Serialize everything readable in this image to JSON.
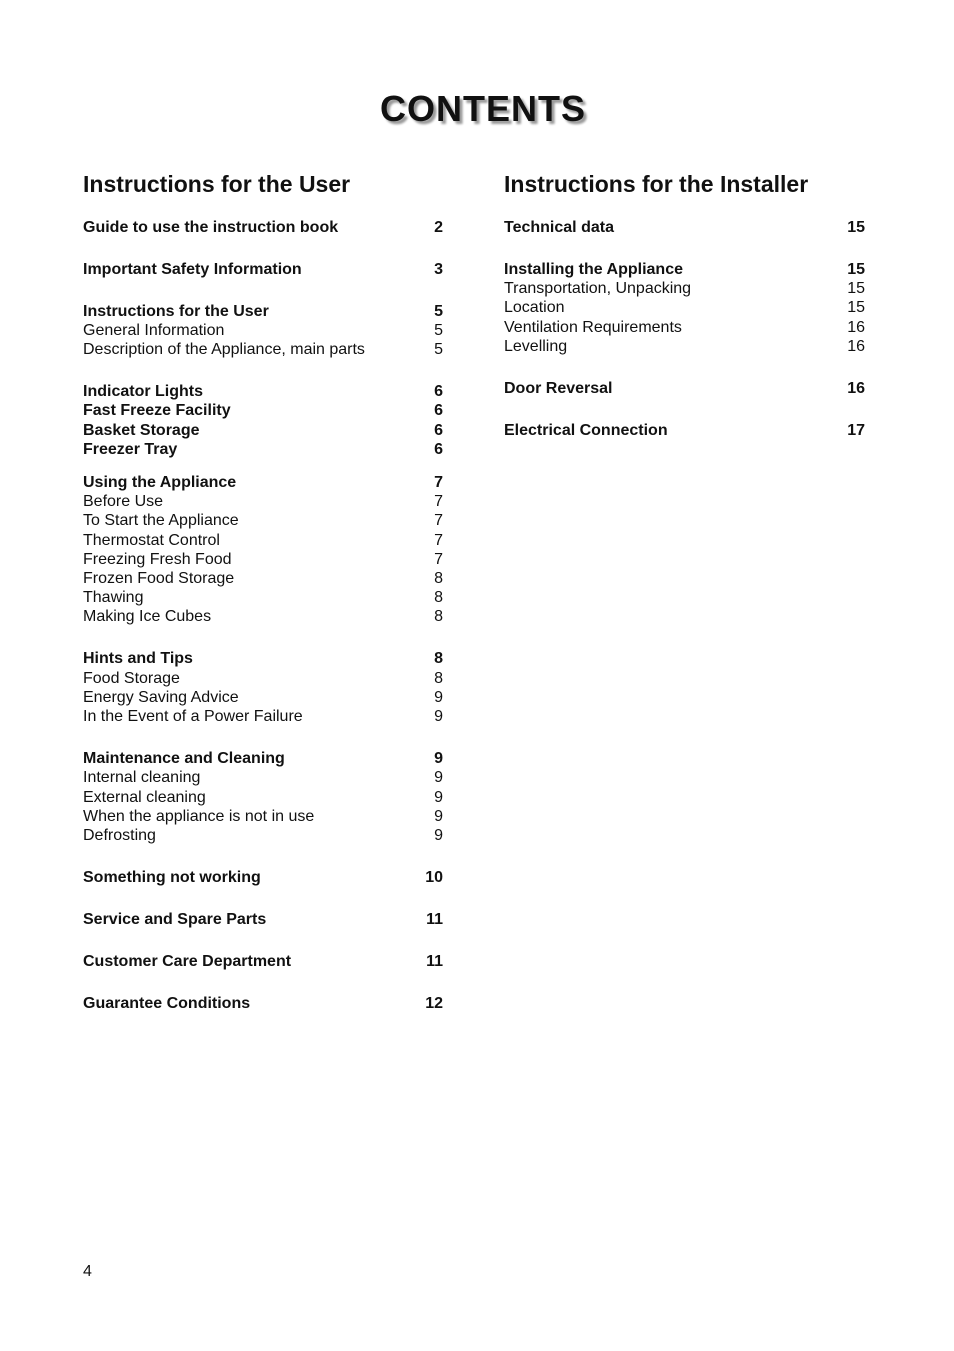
{
  "title": "CONTENTS",
  "user_section": {
    "heading": "Instructions for the User",
    "entries": [
      {
        "label": "Guide to use the instruction book",
        "page": "2",
        "bold": true
      },
      {
        "label": "Important Safety Information",
        "page": "3",
        "bold": true
      },
      {
        "label": "Instructions for the User",
        "page": "5",
        "bold": true
      },
      {
        "label": "General Information",
        "page": "5",
        "bold": false
      },
      {
        "label": "Description of the Appliance, main parts",
        "page": "5",
        "bold": false
      },
      {
        "label": "Indicator Lights",
        "page": "6",
        "bold": true
      },
      {
        "label": "Fast Freeze Facility",
        "page": "6",
        "bold": true
      },
      {
        "label": "Basket Storage",
        "page": "6",
        "bold": true
      },
      {
        "label": "Freezer Tray",
        "page": "6",
        "bold": true
      },
      {
        "label": "Using the Appliance",
        "page": "7",
        "bold": true
      },
      {
        "label": "Before Use",
        "page": "7",
        "bold": false
      },
      {
        "label": "To Start the Appliance",
        "page": "7",
        "bold": false
      },
      {
        "label": "Thermostat Control",
        "page": "7",
        "bold": false
      },
      {
        "label": "Freezing Fresh Food",
        "page": "7",
        "bold": false
      },
      {
        "label": "Frozen Food Storage",
        "page": "8",
        "bold": false
      },
      {
        "label": "Thawing",
        "page": "8",
        "bold": false
      },
      {
        "label": "Making Ice Cubes",
        "page": "8",
        "bold": false
      },
      {
        "label": "Hints and Tips",
        "page": "8",
        "bold": true
      },
      {
        "label": "Food Storage",
        "page": "8",
        "bold": false
      },
      {
        "label": "Energy Saving Advice",
        "page": "9",
        "bold": false
      },
      {
        "label": "In the Event of a Power Failure",
        "page": "9",
        "bold": false
      },
      {
        "label": "Maintenance and Cleaning",
        "page": "9",
        "bold": true
      },
      {
        "label": "Internal cleaning",
        "page": "9",
        "bold": false
      },
      {
        "label": "External cleaning",
        "page": "9",
        "bold": false
      },
      {
        "label": "When the appliance is not in use",
        "page": "9",
        "bold": false
      },
      {
        "label": "Defrosting",
        "page": "9",
        "bold": false
      },
      {
        "label": "Something not working",
        "page": "10",
        "bold": true
      },
      {
        "label": "Service and Spare Parts",
        "page": "11",
        "bold": true
      },
      {
        "label": "Customer Care Department",
        "page": "11",
        "bold": true
      },
      {
        "label": "Guarantee Conditions",
        "page": "12",
        "bold": true
      }
    ]
  },
  "installer_section": {
    "heading": "Instructions for the Installer",
    "entries": [
      {
        "label": "Technical data",
        "page": "15",
        "bold": true
      },
      {
        "label": "Installing the Appliance",
        "page": "15",
        "bold": true
      },
      {
        "label": "Transportation, Unpacking",
        "page": "15",
        "bold": false
      },
      {
        "label": "Location",
        "page": "15",
        "bold": false
      },
      {
        "label": "Ventilation Requirements",
        "page": "16",
        "bold": false
      },
      {
        "label": "Levelling",
        "page": "16",
        "bold": false
      },
      {
        "label": "Door Reversal",
        "page": "16",
        "bold": true
      },
      {
        "label": "Electrical Connection",
        "page": "17",
        "bold": true
      }
    ]
  },
  "footer": {
    "page_number": "4"
  }
}
